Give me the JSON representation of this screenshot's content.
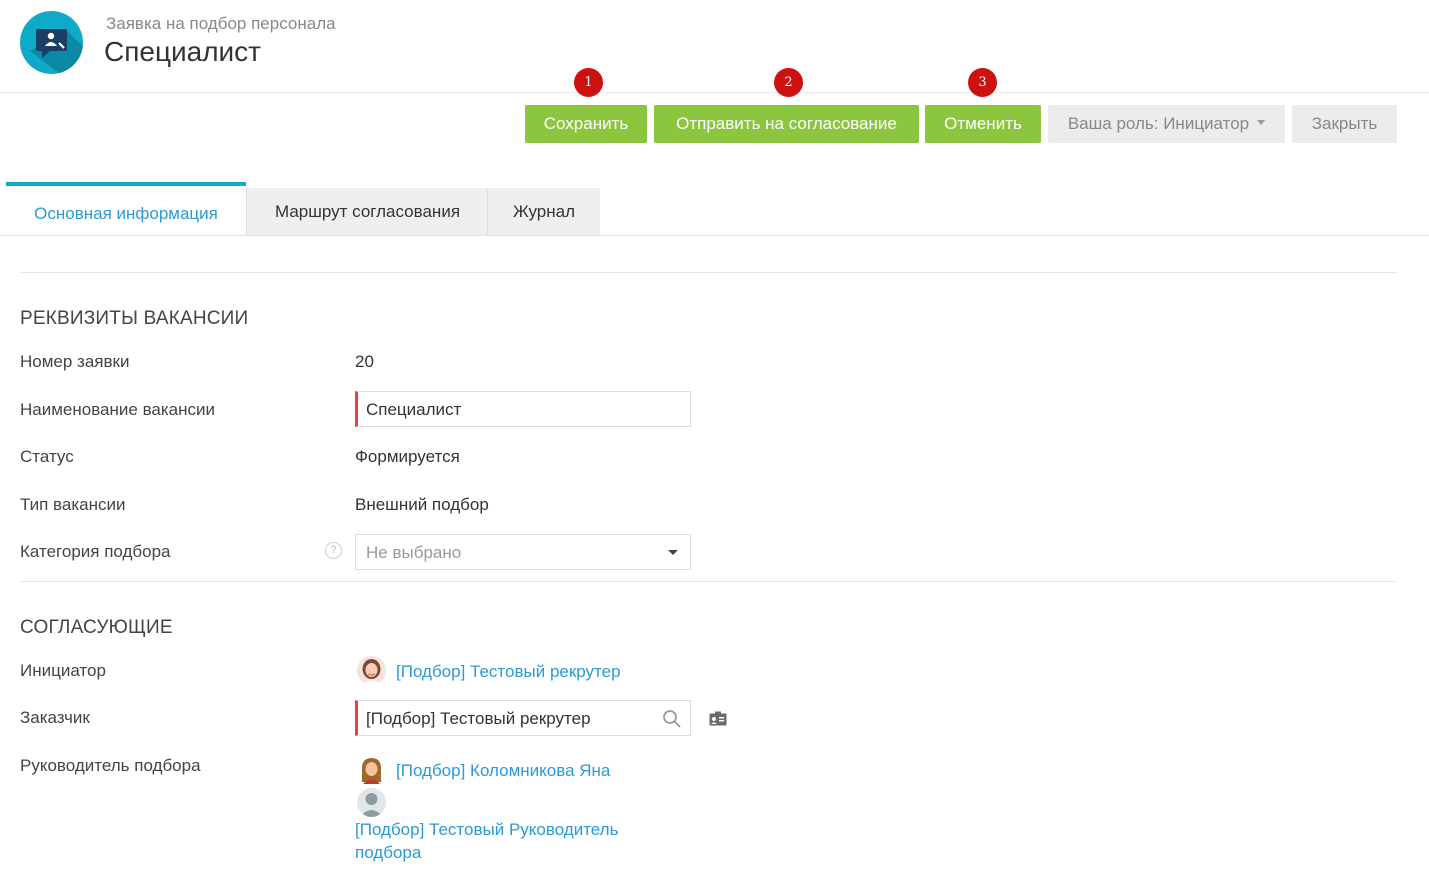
{
  "header": {
    "subtitle": "Заявка на подбор персонала",
    "title": "Специалист",
    "logo_icon": "chat-user-icon"
  },
  "toolbar": {
    "save_label": "Сохранить",
    "send_label": "Отправить на согласование",
    "cancel_label": "Отменить",
    "role_label": "Ваша роль: Инициатор",
    "close_label": "Закрыть",
    "badges": [
      "1",
      "2",
      "3"
    ]
  },
  "tabs": [
    {
      "label": "Основная информация",
      "active": true
    },
    {
      "label": "Маршрут согласования",
      "active": false
    },
    {
      "label": "Журнал",
      "active": false
    }
  ],
  "vacancy": {
    "section_title": "РЕКВИЗИТЫ ВАКАНСИИ",
    "number_label": "Номер заявки",
    "number_value": "20",
    "name_label": "Наименование вакансии",
    "name_value": "Специалист",
    "status_label": "Статус",
    "status_value": "Формируется",
    "type_label": "Тип вакансии",
    "type_value": "Внешний подбор",
    "category_label": "Категория подбора",
    "category_placeholder": "Не выбрано",
    "help_icon": "?"
  },
  "approvers": {
    "section_title": "СОГЛАСУЮЩИЕ",
    "initiator_label": "Инициатор",
    "initiator_value": "[Подбор] Тестовый рекрутер",
    "customer_label": "Заказчик",
    "customer_value": "[Подбор] Тестовый рекрутер",
    "manager_label": "Руководитель подбора",
    "manager_1": "[Подбор] Коломникова Яна",
    "manager_2_line1": "[Подбор] Тестовый Руководитель",
    "manager_2_line2": "подбора"
  },
  "colors": {
    "accent_green": "#8cc63f",
    "link_blue": "#2b9ad6",
    "badge_red": "#cc1111",
    "required_red": "#e04343",
    "logo_teal": "#0faac8"
  }
}
